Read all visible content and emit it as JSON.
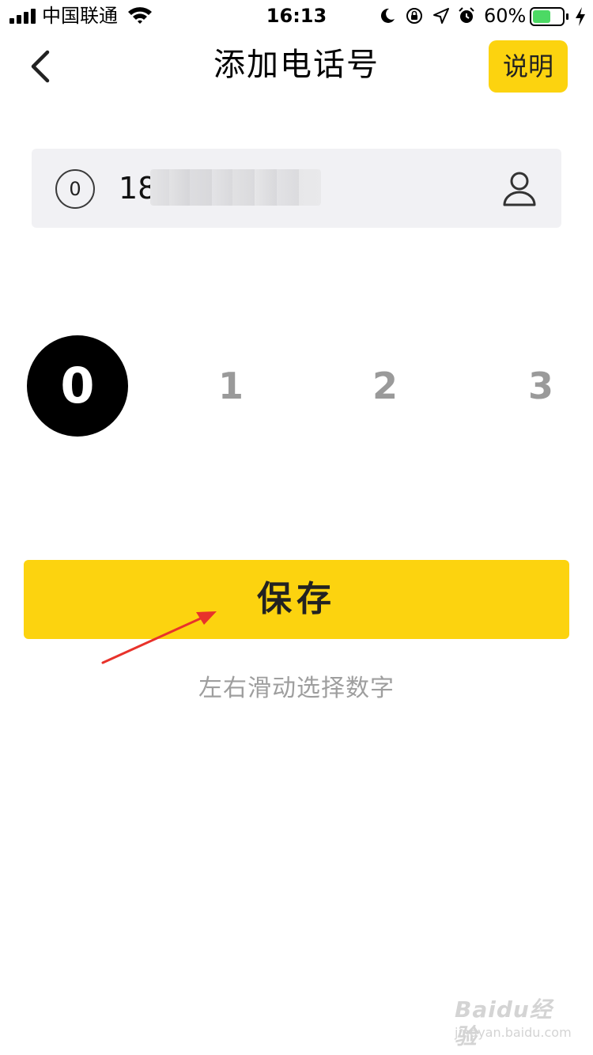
{
  "status_bar": {
    "carrier": "中国联通",
    "time": "16:13",
    "battery": "60%",
    "battery_level": 0.6
  },
  "nav": {
    "title": "添加电话号",
    "help_label": "说明"
  },
  "phone": {
    "prefix": "0",
    "value_visible": "18"
  },
  "picker": {
    "selected": "0",
    "digits": [
      "1",
      "2",
      "3"
    ]
  },
  "save_label": "保存",
  "hint": "左右滑动选择数字",
  "watermark": {
    "logo": "Baidu经验",
    "url": "jingyan.baidu.com"
  },
  "colors": {
    "accent": "#FCD30F",
    "input_bg": "#F1F1F4",
    "annotation_arrow": "#E8322B"
  },
  "icons": {
    "back": "chevron-left-icon",
    "contact": "person-icon"
  }
}
